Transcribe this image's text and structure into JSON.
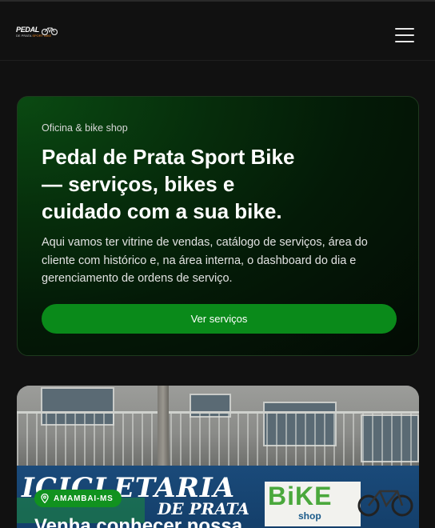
{
  "header": {
    "logo_text": "PEDAL",
    "logo_sub_a": "DE PRATA",
    "logo_sub_b": "SPORT BIKE"
  },
  "hero": {
    "eyebrow": "Oficina & bike shop",
    "title": "Pedal de Prata Sport Bike — serviços, bikes e cuidado com a sua bike.",
    "description": "Aqui vamos ter vitrine de vendas, catálogo de serviços, área do cliente com histórico e, na área interna, o dashboard do dia e gerenciamento de ordens de serviço.",
    "cta_label": "Ver serviços"
  },
  "store": {
    "badge": "AMAMBAI-MS",
    "heading": "Venha conhecer nossa",
    "sign_main": "ICICLETARIA",
    "sign_sub": "DE PRATA",
    "bike_logo": "BiKE",
    "bike_shop": "shop"
  },
  "colors": {
    "accent_green": "#0a8a1a",
    "badge_green": "#11921f",
    "background": "#111111"
  },
  "icons": {
    "menu": "hamburger-menu-icon",
    "location": "map-pin-icon"
  }
}
